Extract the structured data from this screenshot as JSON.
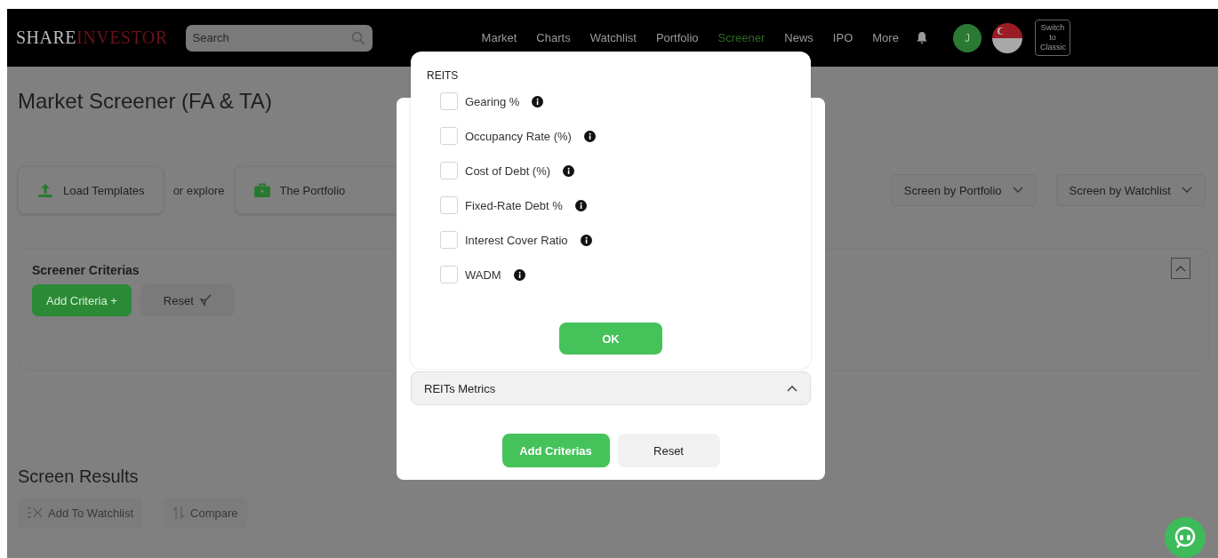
{
  "header": {
    "logo": {
      "first": "SHARE",
      "second": "INVESTOR"
    },
    "search": {
      "placeholder": "Search"
    },
    "nav": [
      {
        "label": "Market",
        "selected": false
      },
      {
        "label": "Charts",
        "selected": false
      },
      {
        "label": "Watchlist",
        "selected": false
      },
      {
        "label": "Portfolio",
        "selected": false
      },
      {
        "label": "Screener",
        "selected": true
      },
      {
        "label": "News",
        "selected": false
      },
      {
        "label": "IPO",
        "selected": false
      },
      {
        "label": "More",
        "selected": false
      }
    ],
    "avatar": "J",
    "switch_button": "Switch to Classic"
  },
  "page": {
    "title": "Market Screener (FA & TA)",
    "load_templates": "Load Templates",
    "or_explore": "or explore",
    "portfolio_button": "The Portfolio",
    "dropdowns": [
      "Screen by Portfolio",
      "Screen by Watchlist"
    ],
    "criteria": {
      "title": "Screener Criterias",
      "add_button": "Add Criteria +",
      "reset_button": "Reset"
    },
    "results": {
      "title": "Screen Results",
      "actions": [
        "Add To Watchlist",
        "Compare"
      ]
    }
  },
  "modal": {
    "section": {
      "label": "REITs Metrics",
      "expanded": true
    },
    "buttons": {
      "primary": "Add Criterias",
      "secondary": "Reset"
    }
  },
  "popover": {
    "heading": "REITS",
    "options": [
      {
        "label": "Gearing %",
        "checked": false
      },
      {
        "label": "Occupancy Rate (%)",
        "checked": false
      },
      {
        "label": "Cost of Debt (%)",
        "checked": false
      },
      {
        "label": "Fixed-Rate Debt %",
        "checked": false
      },
      {
        "label": "Interest Cover Ratio",
        "checked": false
      },
      {
        "label": "WADM",
        "checked": false
      }
    ],
    "ok": "OK"
  }
}
